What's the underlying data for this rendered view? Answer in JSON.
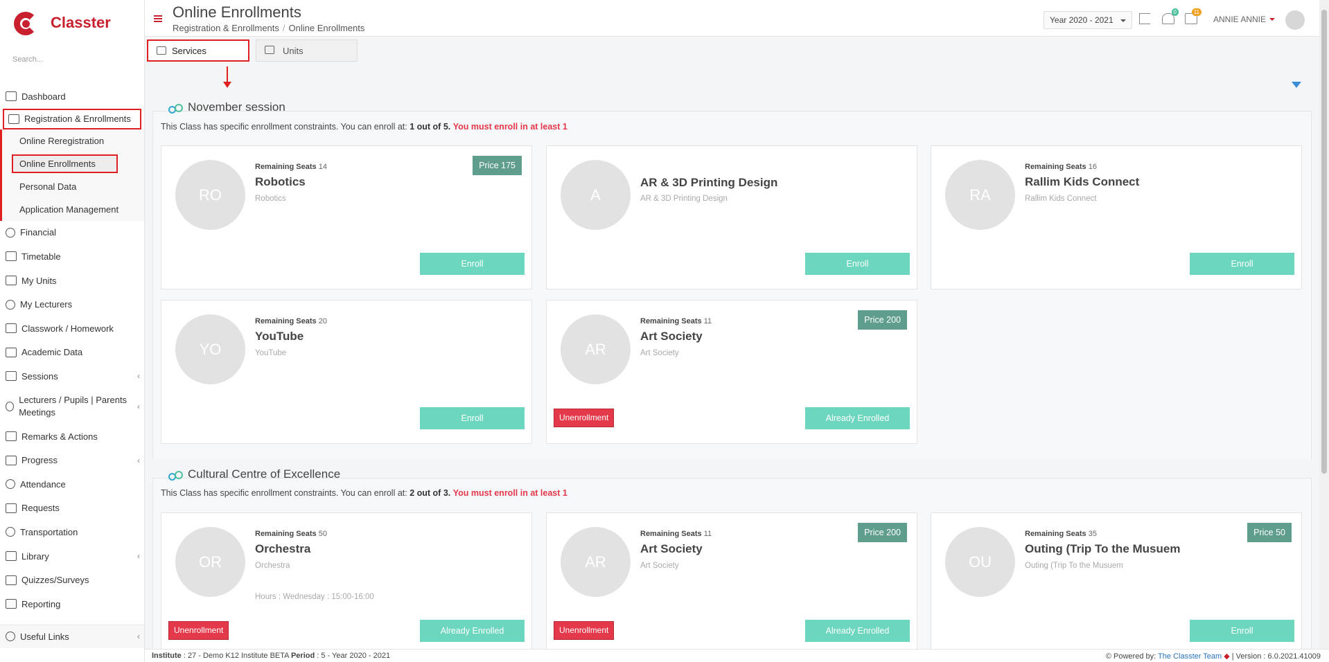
{
  "app": {
    "brand": "Classter",
    "search_placeholder": "Search..."
  },
  "sidebar": {
    "items": [
      {
        "label": "Dashboard"
      },
      {
        "label": "Registration & Enrollments"
      },
      {
        "label": "Financial"
      },
      {
        "label": "Timetable"
      },
      {
        "label": "My Units"
      },
      {
        "label": "My Lecturers"
      },
      {
        "label": "Classwork / Homework"
      },
      {
        "label": "Academic Data"
      },
      {
        "label": "Sessions"
      },
      {
        "label": "Lecturers / Pupils | Parents Meetings"
      },
      {
        "label": "Remarks & Actions"
      },
      {
        "label": "Progress"
      },
      {
        "label": "Attendance"
      },
      {
        "label": "Requests"
      },
      {
        "label": "Transportation"
      },
      {
        "label": "Library"
      },
      {
        "label": "Quizzes/Surveys"
      },
      {
        "label": "Reporting"
      },
      {
        "label": "Useful Links"
      }
    ],
    "subitems": [
      {
        "label": "Online Reregistration"
      },
      {
        "label": "Online Enrollments"
      },
      {
        "label": "Personal Data"
      },
      {
        "label": "Application Management"
      }
    ]
  },
  "header": {
    "title": "Online Enrollments",
    "breadcrumb": [
      "Registration & Enrollments",
      "Online Enrollments"
    ],
    "year_select": "Year 2020 - 2021",
    "notifications_count": "0",
    "messages_count": "11",
    "user_name": "ANNIE ANNIE"
  },
  "tabs": [
    {
      "label": "Services"
    },
    {
      "label": "Units"
    }
  ],
  "sessions": [
    {
      "title": "November session",
      "constraint_prefix": "This Class has specific enrollment constraints. You can enroll at:",
      "constraint_value": "1 out of 5.",
      "constraint_must": "You must enroll in at least 1",
      "cards": [
        {
          "initials": "RO",
          "seats_label": "Remaining Seats",
          "seats": "14",
          "name": "Robotics",
          "subtitle": "Robotics",
          "price": "Price 175",
          "action": "Enroll"
        },
        {
          "initials": "A",
          "seats_label": "",
          "seats": "",
          "name": "AR & 3D Printing Design",
          "subtitle": "AR & 3D Printing Design",
          "price": "",
          "action": "Enroll"
        },
        {
          "initials": "RA",
          "seats_label": "Remaining Seats",
          "seats": "16",
          "name": "Rallim Kids Connect",
          "subtitle": "Rallim Kids Connect",
          "price": "",
          "action": "Enroll"
        },
        {
          "initials": "YO",
          "seats_label": "Remaining Seats",
          "seats": "20",
          "name": "YouTube",
          "subtitle": "YouTube",
          "price": "",
          "action": "Enroll"
        },
        {
          "initials": "AR",
          "seats_label": "Remaining Seats",
          "seats": "11",
          "name": "Art Society",
          "subtitle": "Art Society",
          "price": "Price 200",
          "action": "Already Enrolled",
          "unenroll": "Unenrollment"
        }
      ]
    },
    {
      "title": "Cultural Centre of Excellence",
      "constraint_prefix": "This Class has specific enrollment constraints. You can enroll at:",
      "constraint_value": "2 out of 3.",
      "constraint_must": "You must enroll in at least 1",
      "cards": [
        {
          "initials": "OR",
          "seats_label": "Remaining Seats",
          "seats": "50",
          "name": "Orchestra",
          "subtitle": "Orchestra",
          "hours": "Hours : Wednesday : 15:00-16:00",
          "price": "",
          "action": "Already Enrolled",
          "unenroll": "Unenrollment"
        },
        {
          "initials": "AR",
          "seats_label": "Remaining Seats",
          "seats": "11",
          "name": "Art Society",
          "subtitle": "Art Society",
          "price": "Price 200",
          "action": "Already Enrolled",
          "unenroll": "Unenrollment"
        },
        {
          "initials": "OU",
          "seats_label": "Remaining Seats",
          "seats": "35",
          "name": "Outing (Trip To the Musuem",
          "subtitle": "Outing (Trip To the Musuem",
          "price": "Price 50",
          "action": "Enroll"
        }
      ]
    }
  ],
  "footer": {
    "institute_label": "Institute",
    "institute_value": ": 27 - Demo K12 Institute BETA",
    "period_label": "Period",
    "period_value": ": 5 - Year 2020 - 2021",
    "powered_label": "Powered by:",
    "powered_link": "The Classter Team",
    "version": "| Version : 6.0.2021.41009"
  },
  "colors": {
    "brand": "#c9202f",
    "enroll": "#6dd6be",
    "price": "#5f9e8c",
    "unenroll": "#e3394a",
    "highlight": "#e02020"
  }
}
